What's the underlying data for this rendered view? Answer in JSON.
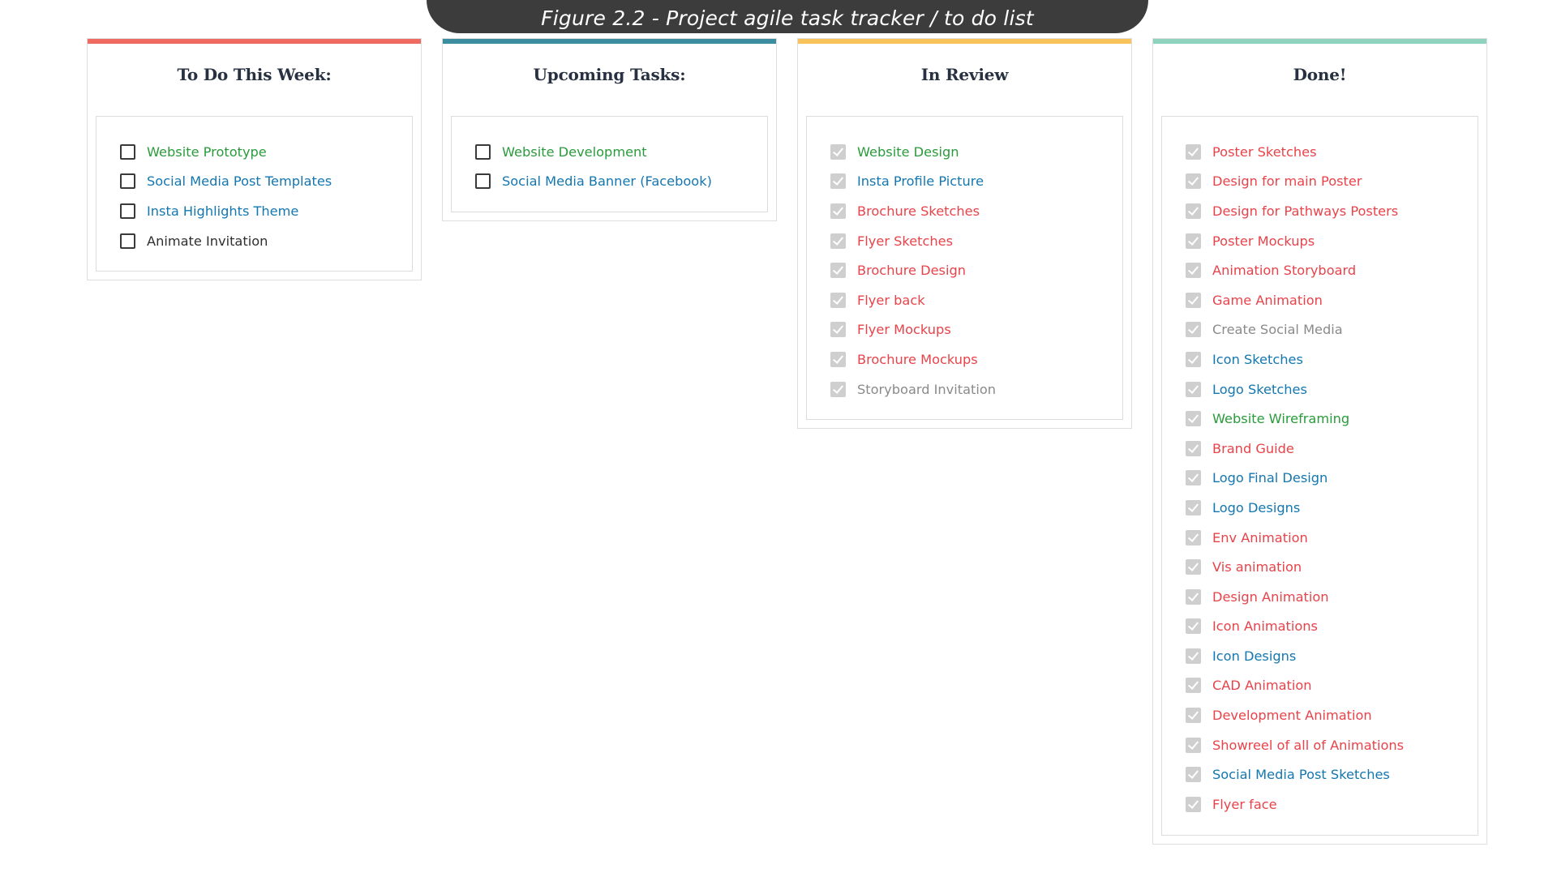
{
  "caption": "Figure 2.2 - Project agile task tracker / to do list",
  "colors": {
    "green": "#2a9b3c",
    "blue": "#1477b0",
    "red": "#e8434a",
    "dark": "#2f2f2f",
    "gray": "#8a8a8a"
  },
  "columns": [
    {
      "title": "To Do This Week:",
      "accent_color": "#ef6b62",
      "state": "unchecked",
      "tasks": [
        {
          "label": "Website Prototype",
          "color": "#2a9b3c",
          "checked": false
        },
        {
          "label": "Social Media Post Templates",
          "color": "#1477b0",
          "checked": false
        },
        {
          "label": "Insta Highlights Theme",
          "color": "#1477b0",
          "checked": false
        },
        {
          "label": "Animate Invitation",
          "color": "#2f2f2f",
          "checked": false
        }
      ]
    },
    {
      "title": "Upcoming Tasks:",
      "accent_color": "#3d8da0",
      "state": "unchecked",
      "tasks": [
        {
          "label": "Website Development",
          "color": "#2a9b3c",
          "checked": false
        },
        {
          "label": "Social Media Banner (Facebook)",
          "color": "#1477b0",
          "checked": false
        }
      ]
    },
    {
      "title": "In Review",
      "accent_color": "#f7c35a",
      "state": "checked",
      "tasks": [
        {
          "label": "Website Design",
          "color": "#2a9b3c",
          "checked": true
        },
        {
          "label": "Insta Profile Picture",
          "color": "#1477b0",
          "checked": true
        },
        {
          "label": "Brochure Sketches",
          "color": "#e8434a",
          "checked": true
        },
        {
          "label": "Flyer Sketches",
          "color": "#e8434a",
          "checked": true
        },
        {
          "label": "Brochure Design",
          "color": "#e8434a",
          "checked": true
        },
        {
          "label": "Flyer back",
          "color": "#e8434a",
          "checked": true
        },
        {
          "label": "Flyer Mockups",
          "color": "#e8434a",
          "checked": true
        },
        {
          "label": "Brochure Mockups",
          "color": "#e8434a",
          "checked": true
        },
        {
          "label": "Storyboard Invitation",
          "color": "#8a8a8a",
          "checked": true
        }
      ]
    },
    {
      "title": "Done!",
      "accent_color": "#8fd3bf",
      "state": "checked",
      "tasks": [
        {
          "label": "Poster Sketches",
          "color": "#e8434a",
          "checked": true
        },
        {
          "label": "Design for main Poster",
          "color": "#e8434a",
          "checked": true
        },
        {
          "label": "Design for Pathways Posters",
          "color": "#e8434a",
          "checked": true
        },
        {
          "label": "Poster Mockups",
          "color": "#e8434a",
          "checked": true
        },
        {
          "label": "Animation Storyboard",
          "color": "#e8434a",
          "checked": true
        },
        {
          "label": "Game Animation",
          "color": "#e8434a",
          "checked": true
        },
        {
          "label": "Create Social Media",
          "color": "#8a8a8a",
          "checked": true
        },
        {
          "label": "Icon Sketches",
          "color": "#1477b0",
          "checked": true
        },
        {
          "label": "Logo Sketches",
          "color": "#1477b0",
          "checked": true
        },
        {
          "label": "Website Wireframing",
          "color": "#2a9b3c",
          "checked": true
        },
        {
          "label": "Brand Guide",
          "color": "#e8434a",
          "checked": true
        },
        {
          "label": "Logo Final Design",
          "color": "#1477b0",
          "checked": true
        },
        {
          "label": "Logo Designs",
          "color": "#1477b0",
          "checked": true
        },
        {
          "label": "Env Animation",
          "color": "#e8434a",
          "checked": true
        },
        {
          "label": "Vis animation",
          "color": "#e8434a",
          "checked": true
        },
        {
          "label": "Design Animation",
          "color": "#e8434a",
          "checked": true
        },
        {
          "label": "Icon Animations",
          "color": "#e8434a",
          "checked": true
        },
        {
          "label": "Icon Designs",
          "color": "#1477b0",
          "checked": true
        },
        {
          "label": "CAD Animation",
          "color": "#e8434a",
          "checked": true
        },
        {
          "label": "Development Animation",
          "color": "#e8434a",
          "checked": true
        },
        {
          "label": "Showreel of all of Animations",
          "color": "#e8434a",
          "checked": true
        },
        {
          "label": "Social Media Post Sketches",
          "color": "#1477b0",
          "checked": true
        },
        {
          "label": "Flyer face",
          "color": "#e8434a",
          "checked": true
        }
      ]
    }
  ]
}
